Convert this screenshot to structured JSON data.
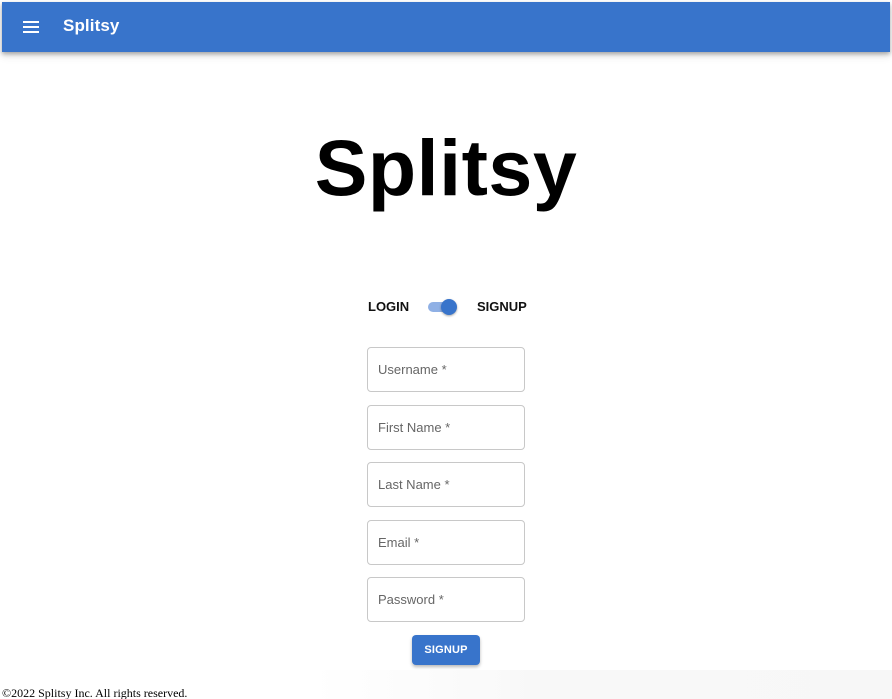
{
  "app_bar": {
    "menu_icon": "menu-icon",
    "title": "Splitsy",
    "color": "#3874cb"
  },
  "hero": {
    "title": "Splitsy"
  },
  "mode_switch": {
    "login_label": "LOGIN",
    "signup_label": "SIGNUP",
    "selected": "SIGNUP",
    "accent": "#3874cb"
  },
  "form": {
    "fields": [
      {
        "label": "Username *",
        "value": ""
      },
      {
        "label": "First Name *",
        "value": ""
      },
      {
        "label": "Last Name *",
        "value": ""
      },
      {
        "label": "Email *",
        "value": ""
      },
      {
        "label": "Password *",
        "value": ""
      }
    ],
    "submit_label": "SIGNUP"
  },
  "footer": {
    "text": "©2022 Splitsy Inc. All rights reserved."
  }
}
